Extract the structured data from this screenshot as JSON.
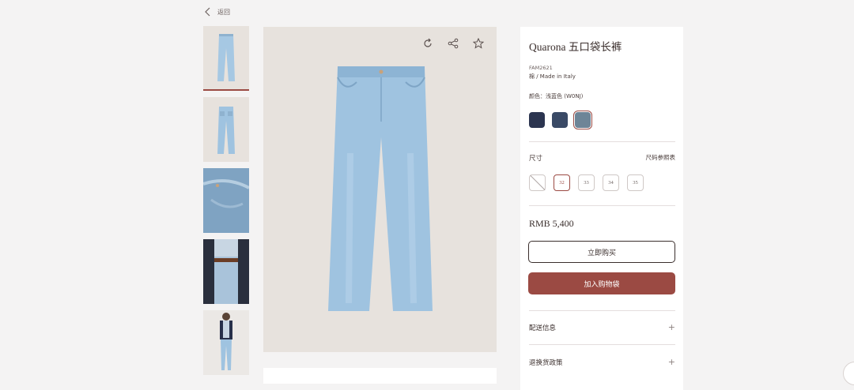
{
  "nav": {
    "back_label": "返回"
  },
  "product": {
    "title": "Quarona 五口袋长裤",
    "sku": "FAM2621",
    "material": "棉 / Made in Italy",
    "color_label": "颜色：浅蓝色 (W0NJ)",
    "swatches": [
      {
        "name": "dark-indigo",
        "color": "#2c3550",
        "selected": false
      },
      {
        "name": "navy-blue",
        "color": "#3a4a66",
        "selected": false
      },
      {
        "name": "light-blue",
        "color": "#6e8597",
        "selected": true
      }
    ],
    "size_label": "尺寸",
    "size_guide_label": "尺码参照表",
    "sizes": [
      {
        "label": "",
        "available": false,
        "selected": false
      },
      {
        "label": "32",
        "available": true,
        "selected": true
      },
      {
        "label": "33",
        "available": true,
        "selected": false
      },
      {
        "label": "34",
        "available": true,
        "selected": false
      },
      {
        "label": "35",
        "available": true,
        "selected": false
      }
    ],
    "price": "RMB 5,400",
    "buy_now_label": "立即购买",
    "add_to_bag_label": "加入购物袋",
    "accordions": [
      {
        "label": "配送信息",
        "icon": "+"
      },
      {
        "label": "退换货政策",
        "icon": "+"
      }
    ]
  },
  "gallery": {
    "thumbnails": [
      "jeans-front",
      "jeans-back",
      "jeans-detail",
      "model-waist",
      "model-full"
    ],
    "active_index": 0,
    "actions": [
      "rotate-icon",
      "share-icon",
      "star-icon"
    ]
  },
  "colors": {
    "accent": "#9b4a43",
    "background": "#f4f3f3",
    "hero_bg": "#e7e2dd",
    "denim": "#9fc3e0"
  }
}
